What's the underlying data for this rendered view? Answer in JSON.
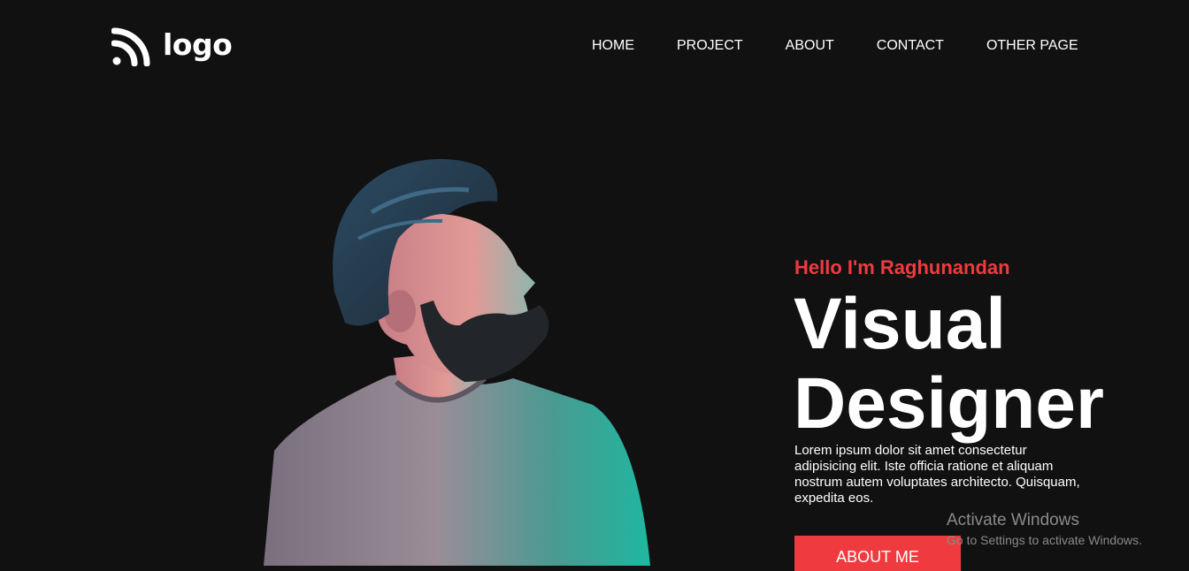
{
  "brand": {
    "logo_text": "logo",
    "logo_icon": "rss-feed-icon"
  },
  "nav": {
    "items": [
      {
        "label": "HOME"
      },
      {
        "label": "PROJECT"
      },
      {
        "label": "ABOUT"
      },
      {
        "label": "CONTACT"
      },
      {
        "label": "OTHER PAGE"
      }
    ]
  },
  "hero": {
    "greeting": "Hello I'm Raghunandan",
    "title_line1": "Visual",
    "title_line2": "Designer",
    "description": "Lorem ipsum dolor sit amet consectetur adipisicing elit. Iste officia ratione et aliquam nostrum autem voluptates architecto. Quisquam, expedita eos.",
    "cta_label": "ABOUT ME",
    "image": "portrait-photo"
  },
  "watermark": {
    "line1": "Activate Windows",
    "line2": "Go to Settings to activate Windows."
  },
  "colors": {
    "background": "#111112",
    "accent": "#ef3b3f",
    "text": "#ffffff",
    "watermark": "#8a8a8a"
  }
}
